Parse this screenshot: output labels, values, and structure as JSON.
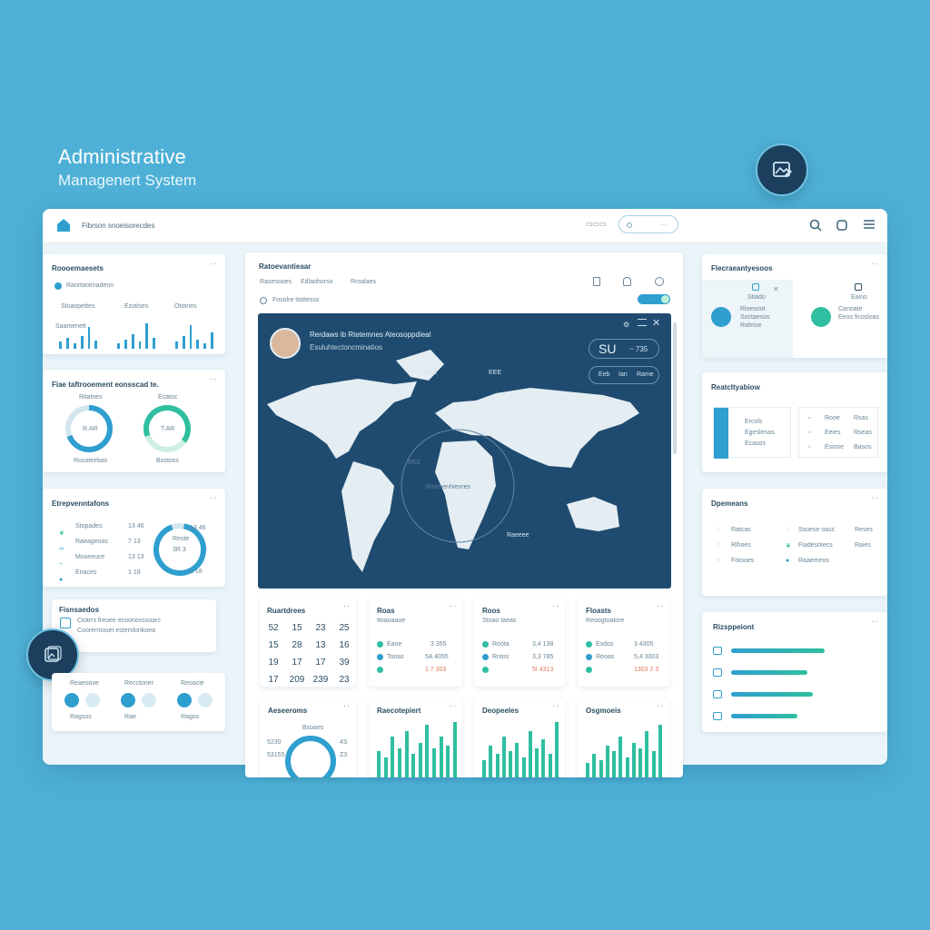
{
  "app": {
    "title_line1": "Administrative",
    "title_line2": "Managenert System"
  },
  "topbar": {
    "breadcrumb": "Fibrson snoeisorecdes",
    "view_toggle": "▭▭▭"
  },
  "left": {
    "card1": {
      "title": "Roooemaesets",
      "sub": "Raortaotmadenn",
      "labels": [
        "Stoaopettes",
        "Ezotises",
        "Ototnes"
      ],
      "caption": "Saamenett"
    },
    "card2": {
      "title": "Fiae taftrooement eonsscad te.",
      "ring1": {
        "title": "Ritatnes",
        "center": "R.AR",
        "foot": "Rosoteebas"
      },
      "ring2": {
        "title": "Ecatoc",
        "center": "T.AR",
        "foot": "Bostoss"
      }
    },
    "card3": {
      "title": "Etrepvenntafons",
      "rows": [
        {
          "label": "Stopades",
          "value": "13 46"
        },
        {
          "label": "Raeageoas",
          "value": "7 13"
        },
        {
          "label": "Moseeuce",
          "value": "13 13"
        },
        {
          "label": "Enaces",
          "value": "1 18"
        }
      ],
      "ring_title": "Reste",
      "ring_center": "3R.3"
    },
    "card4": {
      "title": "Fisnsaedos",
      "line1": "Ctotrrs freoee ecoonovssoarc",
      "line2": "Coorermoset esterxlonkoea"
    },
    "card5": {
      "labels": [
        "Reaeoove",
        "Recctoner",
        "Reoacie"
      ],
      "foot": [
        "Ragsos",
        "Rae",
        "Ragos"
      ]
    }
  },
  "center": {
    "title": "Ratoevantieaar",
    "tabs": [
      "Rasesooes",
      "Edlaohorso",
      "Rroalaes"
    ],
    "radio_label": "Fosolre ttattesss",
    "map": {
      "heading": "Rerdaws ib Rtetemnes Ateosoppdieal",
      "subheading": "Esuluhtectoncminatios",
      "stat_main": "SU",
      "stat_side": "~ 735",
      "pill_labels": [
        "Eeb",
        "Ian",
        "Rame"
      ],
      "labels": [
        "REE",
        "EEE",
        "REE",
        "Rasmenhieores",
        "Raeeee"
      ]
    },
    "calendar": {
      "title": "Ruartdrees",
      "rows": [
        [
          "52",
          "15",
          "23",
          "25"
        ],
        [
          "15",
          "28",
          "13",
          "16"
        ],
        [
          "19",
          "17",
          "17",
          "39"
        ],
        [
          "17",
          "209",
          "239",
          "23"
        ]
      ]
    },
    "stat_cards": [
      {
        "title": "Roas",
        "sub": "Itoaoaaoe",
        "rows": [
          {
            "label": "Eaoe",
            "value": "3 355"
          },
          {
            "label": "Tooas",
            "value": "5A 4055"
          },
          {
            "label": "",
            "value": "1 7 303"
          }
        ]
      },
      {
        "title": "Roos",
        "sub": "Stoao taeas",
        "rows": [
          {
            "label": "Roota",
            "value": "3,4 138"
          },
          {
            "label": "Rntos",
            "value": "3,3 785"
          },
          {
            "label": "",
            "value": "5I 4313"
          }
        ]
      },
      {
        "title": "Floasts",
        "sub": "Reoogtoatore",
        "rows": [
          {
            "label": "Esdos",
            "value": "3 4305"
          },
          {
            "label": "Reoas",
            "value": "5,4 3003"
          },
          {
            "label": "",
            "value": "1303 2 3"
          }
        ]
      }
    ],
    "bottom_cards": [
      {
        "title": "Aeseeroms",
        "center": "Bsoaes",
        "left": [
          "5230",
          "53155"
        ],
        "right": [
          "4S",
          "Z3"
        ]
      },
      {
        "title": "Raecotepiert"
      },
      {
        "title": "Deopeeles"
      },
      {
        "title": "Osgmoeis"
      }
    ]
  },
  "right": {
    "card1": {
      "title": "Flecraeantyesoos",
      "items": [
        {
          "title": "Stiado",
          "sub": "Rioesoot\nSoctaesos\nRaleise"
        },
        {
          "title": "Eaino",
          "sub": "Canoate\nEeos ficosloas"
        }
      ]
    },
    "card2": {
      "title": "Reatcltyabiow",
      "left": [
        "Ercols",
        "Egeslenas",
        "Ecasos"
      ],
      "right": [
        [
          "Rooe",
          "Rsas"
        ],
        [
          "Eeies",
          "Rseas"
        ],
        [
          "Esiose",
          "Basos"
        ]
      ]
    },
    "card3": {
      "title": "Dpemeans",
      "rows": [
        [
          "Ratcas",
          "Ssoese oasc",
          "Reses"
        ],
        [
          "Rlhoes",
          "Fiadesotecs",
          "Raies"
        ],
        [
          "Fotooes",
          "Raaemeos",
          ""
        ]
      ]
    },
    "card4": {
      "title": "Rizsppeiont",
      "bars": [
        0.82,
        0.67,
        0.72,
        0.58
      ]
    }
  },
  "colors": {
    "teal": "#2fbfa0",
    "blue": "#2f9fcf",
    "navy": "#1f4b70",
    "background": "#4eb0d6"
  }
}
